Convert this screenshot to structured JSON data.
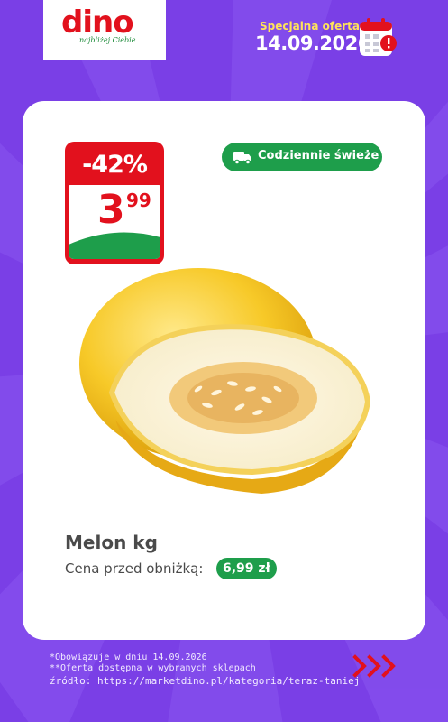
{
  "brand": {
    "name": "dino",
    "tagline": "najbliżej Ciebie"
  },
  "header": {
    "offer_label": "Specjalna oferta",
    "offer_date": "14.09.2026"
  },
  "product": {
    "discount": "-42%",
    "price_main": "3",
    "price_decimal": "99",
    "badge": "Codziennie świeże",
    "name": "Melon kg",
    "before_label": "Cena przed obniżką:",
    "before_value": "6,99 zł"
  },
  "footer": {
    "note1": "*Obowiązuje w dniu 14.09.2026",
    "note2": "**Oferta dostępna w wybranych sklepach",
    "source": "źródło: https://marketdino.pl/kategoria/teraz-taniej"
  },
  "colors": {
    "background": "#7a3fe6",
    "brand_red": "#e2111d",
    "green": "#1e9e4b",
    "yellow": "#ffe35a"
  }
}
